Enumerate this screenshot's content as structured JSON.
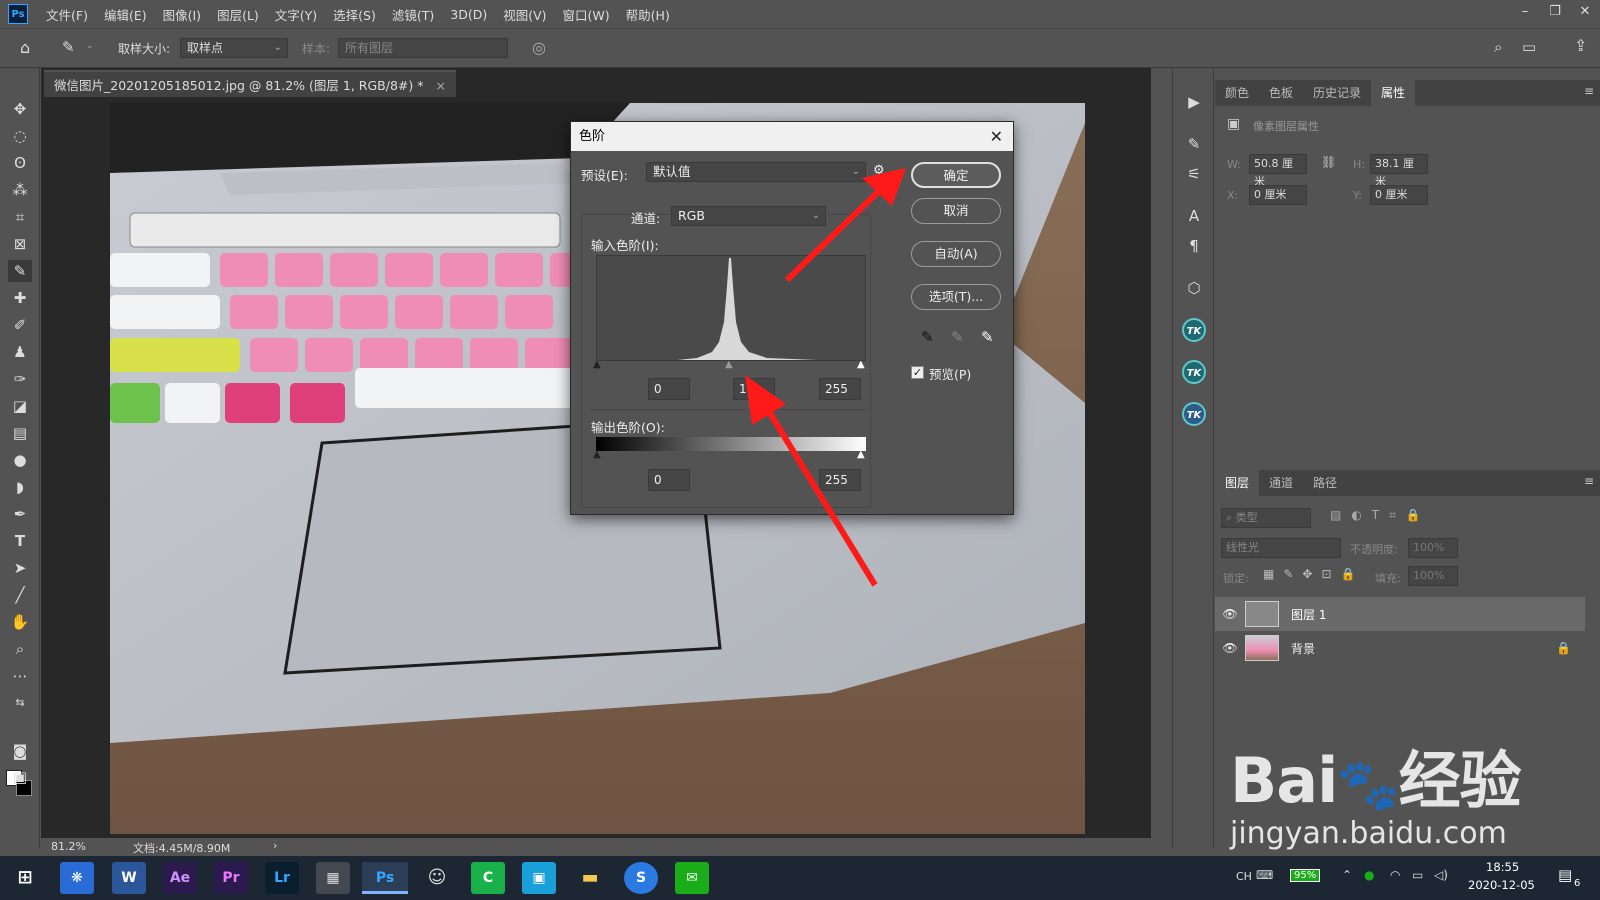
{
  "app": {
    "logo": "Ps"
  },
  "menu": [
    "文件(F)",
    "编辑(E)",
    "图像(I)",
    "图层(L)",
    "文字(Y)",
    "选择(S)",
    "滤镜(T)",
    "3D(D)",
    "视图(V)",
    "窗口(W)",
    "帮助(H)"
  ],
  "window_controls": {
    "minimize": "–",
    "restore": "❐",
    "close": "✕"
  },
  "options_bar": {
    "sample_size_label": "取样大小:",
    "sample_size_value": "取样点",
    "sample_label": "样本:",
    "sample_value": "所有图层"
  },
  "document": {
    "tab_title": "微信图片_20201205185012.jpg @ 81.2% (图层 1, RGB/8#) *",
    "tab_close": "×",
    "zoom": "81.2%",
    "doc_info": "文档:4.45M/8.90M",
    "status_arrow": "›"
  },
  "dialog": {
    "title": "色阶",
    "preset_label": "预设(E):",
    "preset_value": "默认值",
    "channel_label": "通道:",
    "channel_value": "RGB",
    "input_levels_label": "输入色阶(I):",
    "input_black": "0",
    "input_gamma": "1.",
    "input_white": "255",
    "output_levels_label": "输出色阶(O):",
    "output_black": "0",
    "output_white": "255",
    "ok_label": "确定",
    "cancel_label": "取消",
    "auto_label": "自动(A)",
    "options_label": "选项(T)...",
    "preview_label": "预览(P)",
    "preview_checked": true
  },
  "properties_panel": {
    "tabs": [
      "颜色",
      "色板",
      "历史记录",
      "属性"
    ],
    "active_tab": "属性",
    "section_title": "像素图层属性",
    "w_label": "W:",
    "w_value": "50.8 厘米",
    "h_label": "H:",
    "h_value": "38.1 厘米",
    "x_label": "X:",
    "x_value": "0 厘米",
    "y_label": "Y:",
    "y_value": "0 厘米"
  },
  "layers_panel": {
    "tabs": [
      "图层",
      "通道",
      "路径"
    ],
    "active_tab": "图层",
    "filter_placeholder": "类型",
    "blend_mode": "线性光",
    "opacity_label": "不透明度:",
    "opacity_value": "100%",
    "lock_label": "锁定:",
    "fill_label": "填充:",
    "fill_value": "100%",
    "layers": [
      {
        "name": "图层 1",
        "selected": true
      },
      {
        "name": "背景",
        "selected": false,
        "locked": true
      }
    ]
  },
  "taskbar": {
    "apps": [
      "Ae",
      "Pr",
      "Lr",
      "Ps"
    ],
    "ime": "CH",
    "battery": "95%",
    "time": "18:55",
    "date": "2020-12-05",
    "notifications": "6"
  },
  "watermark": {
    "brand": "Bai du经验",
    "url": "jingyan.baidu.com"
  },
  "colors": {
    "arrow": "#ff1a1a",
    "ps_blue": "#31a8ff",
    "taskbar": "#1c2733"
  }
}
